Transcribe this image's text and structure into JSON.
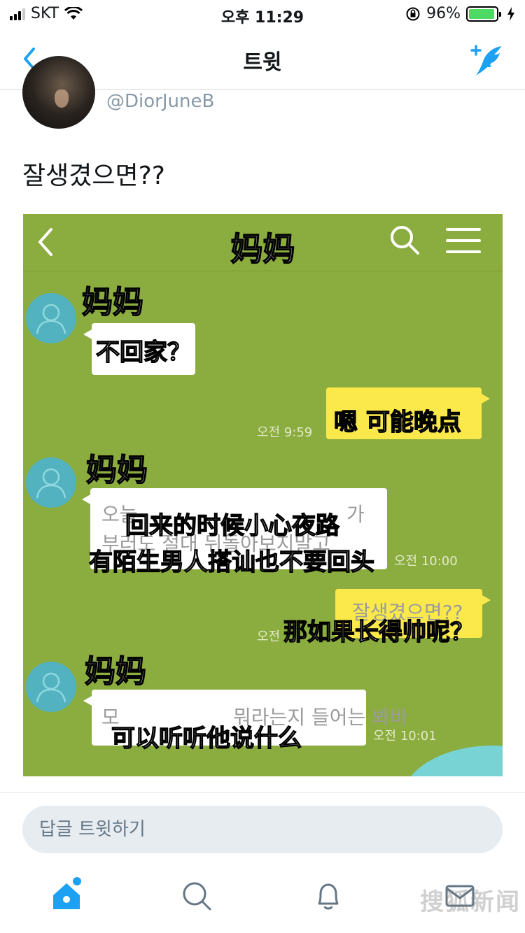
{
  "status_bar": {
    "carrier": "SKT",
    "time": "오후 11:29",
    "battery": "96%",
    "battery_level": 0.96,
    "icons": [
      "signal-icon",
      "wifi-icon",
      "rotation-lock-icon",
      "battery-icon",
      "charging-icon"
    ]
  },
  "nav": {
    "title": "트윗",
    "icons": [
      "back-chevron-icon",
      "compose-tweet-icon"
    ]
  },
  "tweet": {
    "handle": "@DiorJuneB",
    "text": "잘생겼으면??"
  },
  "image": {
    "chat_title": "妈妈",
    "contact_name": "妈妈",
    "captions": [
      "不回家？",
      "嗯 可能晚点",
      "回来的时候小心夜路",
      "有陌生男人搭讪也不要回头",
      "那如果长得帅呢？",
      "可以听听他说什么"
    ],
    "faded_text": [
      "오늘",
      "가",
      "부러도 절대 뒤돌아보지말고",
      "잘생겼으면??",
      "모",
      "뭐라는지 들어는 봐바"
    ],
    "times": [
      "오전 9:59",
      "오전 10:00",
      "오전",
      "오전 10:01"
    ]
  },
  "reply": {
    "placeholder": "답글 트윗하기"
  },
  "tabs": {
    "icons": [
      "home-icon",
      "search-icon",
      "notifications-icon",
      "messages-icon"
    ]
  },
  "watermark": "搜狐新闻",
  "colors": {
    "accent": "#1da1f2",
    "chat_background": "#8bac3e",
    "incoming_bubble": "#ffffff",
    "outgoing_bubble": "#fbe94c",
    "avatar_teal": "#52b2c0"
  }
}
